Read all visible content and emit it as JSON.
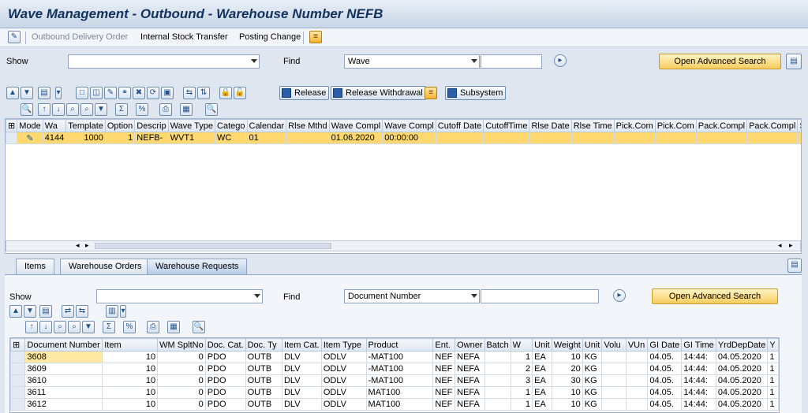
{
  "title": "Wave Management - Outbound - Warehouse Number NEFB",
  "app_toolbar": {
    "outbound_delivery_order": "Outbound Delivery Order",
    "internal_stock_transfer": "Internal Stock Transfer",
    "posting_change": "Posting Change"
  },
  "top_search": {
    "show_label": "Show",
    "show_value": "",
    "find_label": "Find",
    "find_value": "Wave",
    "find_text": "",
    "advanced_search": "Open Advanced Search"
  },
  "wave_toolbar": {
    "release": "Release",
    "release_withdrawal": "Release Withdrawal",
    "subsystem": "Subsystem"
  },
  "wave_table": {
    "columns": [
      "Mode",
      "Wa",
      "Template",
      "Option",
      "Descrip",
      "Wave Type",
      "Catego",
      "Calendar",
      "Rlse Mthd",
      "Wave Compl",
      "Wave Compl",
      "Cutoff Date",
      "CutoffTime",
      "Rlse Date",
      "Rlse Time",
      "Pick.Com",
      "Pick.Com",
      "Pack.Compl",
      "Pack.Compl",
      "S"
    ],
    "rows": [
      [
        "",
        "4144",
        "1000",
        "1",
        "NEFB-",
        "WVT1",
        "WC",
        "01",
        "",
        "01.06.2020",
        "00:00:00",
        "",
        "",
        "",
        "",
        "",
        "",
        "",
        "",
        ""
      ]
    ]
  },
  "tabs": [
    "Items",
    "Warehouse Orders",
    "Warehouse Requests"
  ],
  "bottom_search": {
    "show_label": "Show",
    "show_value": "",
    "find_label": "Find",
    "find_value": "Document Number",
    "find_text": "",
    "advanced_search": "Open Advanced Search"
  },
  "request_table": {
    "columns": [
      "Document Number",
      "Item",
      "WM SpltNo",
      "Doc. Cat.",
      "Doc. Ty",
      "Item Cat.",
      "Item Type",
      "Product",
      "Ent.",
      "Owner",
      "Batch",
      "W",
      "Unit",
      "Weight",
      "Unit",
      "Volu",
      "VUn",
      "GI Date",
      "GI Time",
      "YrdDepDate",
      "Y"
    ],
    "rows": [
      [
        "3608",
        "10",
        "0",
        "PDO",
        "OUTB",
        "DLV",
        "ODLV",
        "-MAT100",
        "NEF",
        "NEFA",
        "",
        "1",
        "EA",
        "10",
        "KG",
        "",
        "",
        "04.05.",
        "14:44:",
        "04.05.2020",
        "1"
      ],
      [
        "3609",
        "10",
        "0",
        "PDO",
        "OUTB",
        "DLV",
        "ODLV",
        "-MAT100",
        "NEF",
        "NEFA",
        "",
        "2",
        "EA",
        "20",
        "KG",
        "",
        "",
        "04.05.",
        "14:44:",
        "04.05.2020",
        "1"
      ],
      [
        "3610",
        "10",
        "0",
        "PDO",
        "OUTB",
        "DLV",
        "ODLV",
        "-MAT100",
        "NEF",
        "NEFA",
        "",
        "3",
        "EA",
        "30",
        "KG",
        "",
        "",
        "04.05.",
        "14:44:",
        "04.05.2020",
        "1"
      ],
      [
        "3611",
        "10",
        "0",
        "PDO",
        "OUTB",
        "DLV",
        "ODLV",
        "MAT100",
        "NEF",
        "NEFA",
        "",
        "1",
        "EA",
        "10",
        "KG",
        "",
        "",
        "04.05.",
        "14:44:",
        "04.05.2020",
        "1"
      ],
      [
        "3612",
        "10",
        "0",
        "PDO",
        "OUTB",
        "DLV",
        "ODLV",
        "MAT100",
        "NEF",
        "NEFA",
        "",
        "1",
        "EA",
        "10",
        "KG",
        "",
        "",
        "04.05.",
        "14:44:",
        "04.05.2020",
        "1"
      ]
    ]
  },
  "colors": {
    "selected_row": "#ffd870",
    "title": "#10325d",
    "button": "#f5cd5e"
  }
}
